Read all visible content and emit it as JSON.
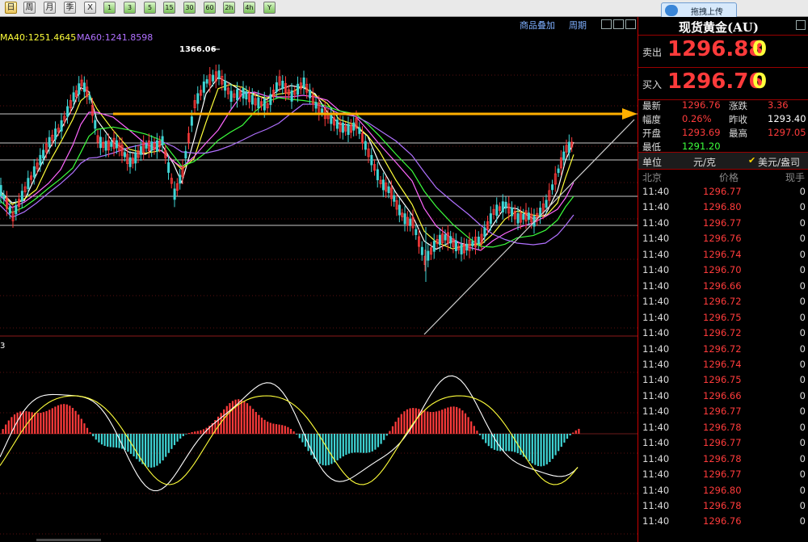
{
  "toolbar": {
    "buttons": [
      "日",
      "周",
      "月",
      "季",
      "X",
      "1",
      "3",
      "5",
      "15",
      "30",
      "60",
      "2h",
      "4h",
      "Y"
    ],
    "upload_label": "拖拽上传"
  },
  "chart": {
    "links": {
      "overlay": "商品叠加",
      "period": "周期"
    },
    "ma_labels": [
      {
        "text": "MA40:1251.4645",
        "color": "#ffff3a"
      },
      {
        "text": "MA60:1241.8598",
        "color": "#b070ff"
      }
    ],
    "peak_label": "1366.06",
    "sub_label": "3",
    "colors": {
      "up": "#ff3b3b",
      "down": "#3fd5d5",
      "arrow": "#ffb000",
      "grid": "#c8c8c8"
    }
  },
  "panel": {
    "title": "现货黄金(AU)",
    "sell": {
      "label": "卖出",
      "value": "1296.88",
      "suffix": "0"
    },
    "buy": {
      "label": "买入",
      "value": "1296.76",
      "suffix": "0"
    },
    "stats": [
      {
        "l1": "最新",
        "v1": "1296.76",
        "c1": "#ff3b3b",
        "l2": "涨跌",
        "v2": "3.36",
        "c2": "#ff3b3b"
      },
      {
        "l1": "幅度",
        "v1": "0.26%",
        "c1": "#ff3b3b",
        "l2": "昨收",
        "v2": "1293.40",
        "c2": "#ffffff"
      },
      {
        "l1": "开盘",
        "v1": "1293.69",
        "c1": "#ff3b3b",
        "l2": "最高",
        "v2": "1297.05",
        "c2": "#ff3b3b"
      },
      {
        "l1": "最低",
        "v1": "1291.20",
        "c1": "#3cff3c",
        "l2": "",
        "v2": "",
        "c2": "#ffffff"
      }
    ],
    "unit": {
      "label": "单位",
      "value": "元/克",
      "toggle": "美元/盎司"
    },
    "tick_header": {
      "time": "北京",
      "price": "价格",
      "volume": "现手"
    },
    "ticks": [
      {
        "time": "11:40",
        "price": "1296.77",
        "vol": "0"
      },
      {
        "time": "11:40",
        "price": "1296.80",
        "vol": "0"
      },
      {
        "time": "11:40",
        "price": "1296.77",
        "vol": "0"
      },
      {
        "time": "11:40",
        "price": "1296.76",
        "vol": "0"
      },
      {
        "time": "11:40",
        "price": "1296.74",
        "vol": "0"
      },
      {
        "time": "11:40",
        "price": "1296.70",
        "vol": "0"
      },
      {
        "time": "11:40",
        "price": "1296.66",
        "vol": "0"
      },
      {
        "time": "11:40",
        "price": "1296.72",
        "vol": "0"
      },
      {
        "time": "11:40",
        "price": "1296.75",
        "vol": "0"
      },
      {
        "time": "11:40",
        "price": "1296.72",
        "vol": "0"
      },
      {
        "time": "11:40",
        "price": "1296.72",
        "vol": "0"
      },
      {
        "time": "11:40",
        "price": "1296.74",
        "vol": "0"
      },
      {
        "time": "11:40",
        "price": "1296.75",
        "vol": "0"
      },
      {
        "time": "11:40",
        "price": "1296.66",
        "vol": "0"
      },
      {
        "time": "11:40",
        "price": "1296.77",
        "vol": "0"
      },
      {
        "time": "11:40",
        "price": "1296.78",
        "vol": "0"
      },
      {
        "time": "11:40",
        "price": "1296.77",
        "vol": "0"
      },
      {
        "time": "11:40",
        "price": "1296.78",
        "vol": "0"
      },
      {
        "time": "11:40",
        "price": "1296.77",
        "vol": "0"
      },
      {
        "time": "11:40",
        "price": "1296.80",
        "vol": "0"
      },
      {
        "time": "11:40",
        "price": "1296.78",
        "vol": "0"
      },
      {
        "time": "11:40",
        "price": "1296.76",
        "vol": "0"
      }
    ]
  }
}
